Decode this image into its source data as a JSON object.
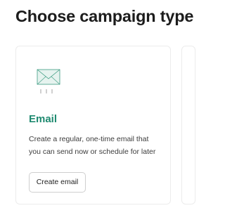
{
  "page": {
    "title": "Choose campaign type"
  },
  "card": {
    "icon": "envelope-icon",
    "title": "Email",
    "description": "Create a regular, one-time email that you can send now or schedule for later",
    "button_label": "Create email"
  },
  "colors": {
    "accent": "#1f8a70",
    "icon_fill": "#e6f3ef",
    "icon_stroke": "#3d9c82",
    "card_border": "#ececec",
    "button_border": "#cfcfcf"
  }
}
